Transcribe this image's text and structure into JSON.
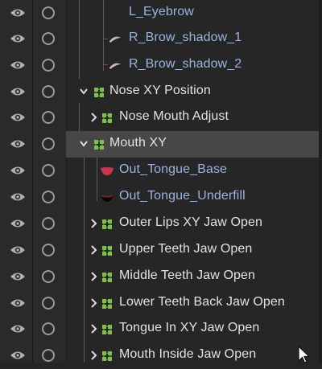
{
  "colors": {
    "background": "#262626",
    "selected_row": "#474747",
    "group_text": "#e2e2e2",
    "layer_text": "#9ab4e0",
    "group_icon": "#7cc04a",
    "icon_gray": "#b0b0b0"
  },
  "rows": [
    {
      "label": "L_Eyebrow",
      "kind": "layer",
      "icon": "eyebrow-thumb"
    },
    {
      "label": "R_Brow_shadow_1",
      "kind": "layer",
      "icon": "brow-shadow-thumb"
    },
    {
      "label": "R_Brow_shadow_2",
      "kind": "layer",
      "icon": "brow-shadow-thumb"
    },
    {
      "label": "Nose XY Position",
      "kind": "group",
      "expanded": true,
      "icon": "deformer-group-icon"
    },
    {
      "label": "Nose Mouth Adjust",
      "kind": "group",
      "expanded": false,
      "icon": "deformer-group-icon"
    },
    {
      "label": "Mouth XY",
      "kind": "group",
      "expanded": true,
      "selected": true,
      "icon": "deformer-group-icon"
    },
    {
      "label": "Out_Tongue_Base",
      "kind": "layer",
      "icon": "tongue-thumb"
    },
    {
      "label": "Out_Tongue_Underfill",
      "kind": "layer",
      "icon": "tongue-underfill-thumb"
    },
    {
      "label": "Outer Lips XY Jaw Open",
      "kind": "group",
      "expanded": false,
      "icon": "deformer-group-icon"
    },
    {
      "label": "Upper Teeth Jaw Open",
      "kind": "group",
      "expanded": false,
      "icon": "deformer-group-icon"
    },
    {
      "label": "Middle Teeth Jaw Open",
      "kind": "group",
      "expanded": false,
      "icon": "deformer-group-icon"
    },
    {
      "label": "Lower Teeth Back Jaw Open",
      "kind": "group",
      "expanded": false,
      "icon": "deformer-group-icon"
    },
    {
      "label": "Tongue In XY Jaw Open",
      "kind": "group",
      "expanded": false,
      "icon": "deformer-group-icon"
    },
    {
      "label": "Mouth Inside Jaw Open",
      "kind": "group",
      "expanded": false,
      "icon": "deformer-group-icon"
    }
  ]
}
